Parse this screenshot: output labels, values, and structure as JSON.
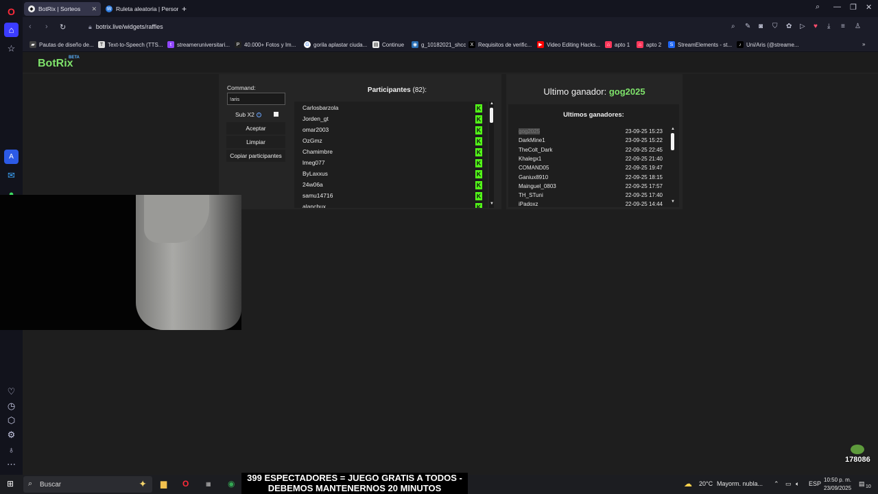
{
  "browser": {
    "tabs": [
      {
        "title": "BotRix | Sorteos",
        "active": true
      },
      {
        "title": "Ruleta aleatoria | Personal",
        "active": false
      }
    ],
    "new_tab": "+",
    "url": "botrix.live/widgets/raffles",
    "bookmarks": [
      "Pautas de diseño de...",
      "Text-to-Speech (TTS...",
      "streameruniversitari...",
      "40.000+ Fotos y Im...",
      "gorila aplastar ciuda...",
      "Continue",
      "g_10182021_shcc",
      "Requisitos de verific...",
      "Video Editing Hacks...",
      "apto 1",
      "apto 2",
      "StreamElements - st...",
      "Uni/Aris (@streame..."
    ]
  },
  "app": {
    "logo": "BotRix",
    "logo_badge": "BETA"
  },
  "raffle": {
    "command_label": "Command:",
    "command_value": "!aris",
    "sub_label": "Sub X2",
    "accept": "Aceptar",
    "clear": "Limpiar",
    "copy": "Copiar participantes",
    "participants_title": "Participantes",
    "participants_count": "(82):",
    "participants": [
      "Carlosbarzola",
      "Jorden_gt",
      "omar2003",
      "OzGmz",
      "Chamimbre",
      "lmeg077",
      "ByLaxxus",
      "24w06a",
      "samu14716",
      "alanchux"
    ],
    "platform_badge": "K",
    "last_winner_label": "Ultimo ganador:",
    "last_winner": "gog2025",
    "winners_title": "Ultimos ganadores:",
    "winners": [
      {
        "name": "gog2025",
        "date": "23-09-25 15:23"
      },
      {
        "name": "DarkMine1",
        "date": "23-09-25 15:22"
      },
      {
        "name": "TheColt_Dark",
        "date": "22-09-25 22:45"
      },
      {
        "name": "Khalegx1",
        "date": "22-09-25 21:40"
      },
      {
        "name": "COMAND05",
        "date": "22-09-25 19:47"
      },
      {
        "name": "Ganiux8910",
        "date": "22-09-25 18:15"
      },
      {
        "name": "Mainguel_0803",
        "date": "22-09-25 17:57"
      },
      {
        "name": "TH_STuni",
        "date": "22-09-25 17:40"
      },
      {
        "name": "iPadoxz",
        "date": "22-09-25 14:44"
      }
    ]
  },
  "stream_overlay": {
    "line1": "399 ESPECTADORES = JUEGO GRATIS A TODOS -",
    "line2": "DEBEMOS MANTENERNOS 20 MINUTOS",
    "counter": "178086"
  },
  "taskbar": {
    "search": "Buscar",
    "weather_temp": "20°C",
    "weather_desc": "Mayorm. nubla...",
    "language": "ESP",
    "time": "10:50 p. m.",
    "date": "23/09/2025",
    "notifications": "10"
  }
}
